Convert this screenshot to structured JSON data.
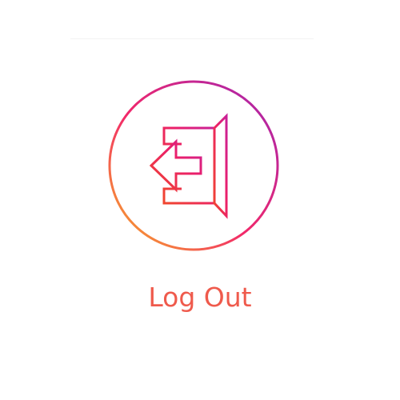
{
  "logout": {
    "label": "Log Out",
    "icon": "logout-door-arrow-icon"
  },
  "colors": {
    "label": "#ef5a4c",
    "gradient_start": "#f7b324",
    "gradient_mid": "#f2286a",
    "gradient_end": "#a225b2"
  }
}
